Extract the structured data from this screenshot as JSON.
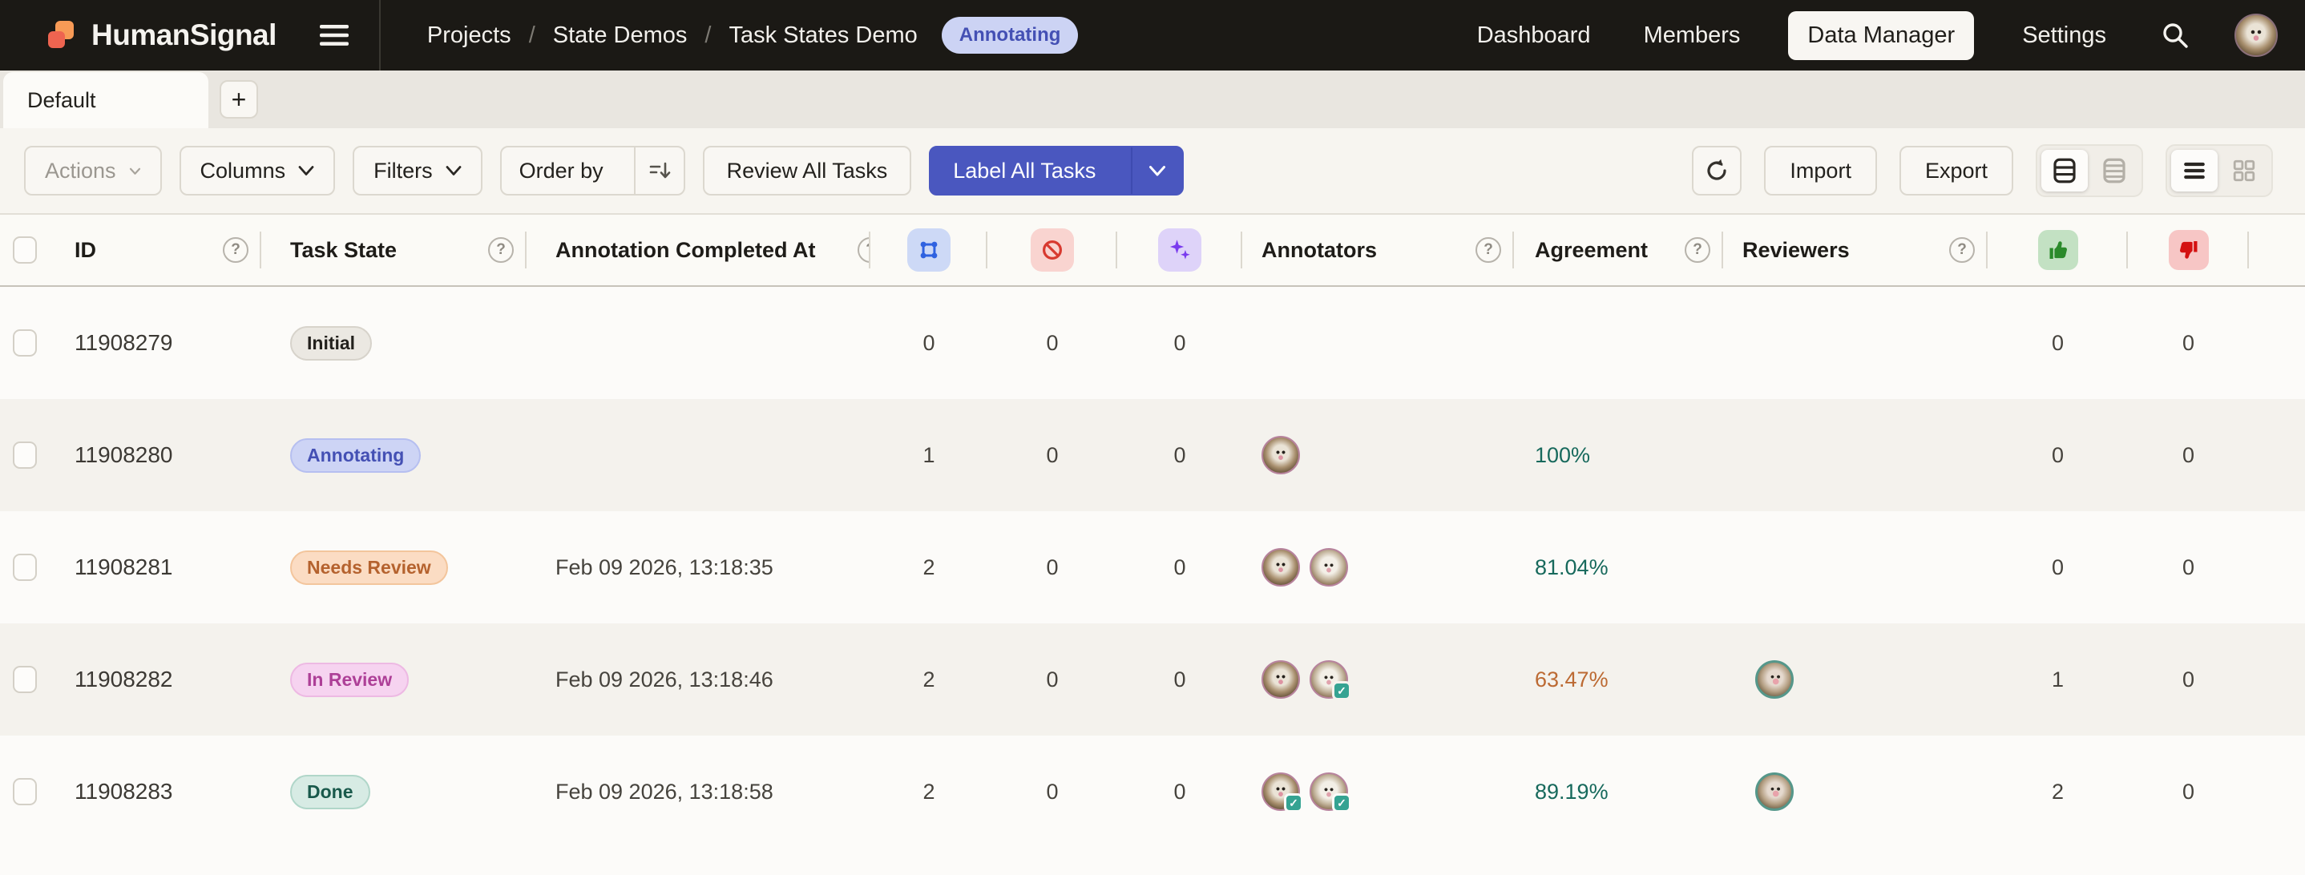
{
  "colors": {
    "primary": "#4a57bf",
    "navbar_bg": "#1b1915",
    "agreement_high": "#17695c",
    "agreement_mid": "#bc6a33",
    "annotations_icon": "#2f62e0",
    "skipped_icon": "#d83a30",
    "predictions_icon": "#7a3bee",
    "accepted_icon": "#2b8a2b",
    "rejected_icon": "#d41111"
  },
  "icons": {
    "hamburger": "menu",
    "search": "magnifier",
    "refresh": "circular-arrow",
    "order_by_sort": "lines-with-down-arrow",
    "annotations_column": "bounding-box-corner-dots",
    "skipped_column": "ban-circle",
    "predictions_column": "sparkles",
    "accepted_column": "thumbs-up",
    "rejected_column": "thumbs-down",
    "help": "?",
    "check": "✓",
    "row_density": "tall-rows / compact-rows",
    "view_mode": "list / grid"
  },
  "navbar": {
    "brand": "HumanSignal",
    "breadcrumb": [
      "Projects",
      "State Demos",
      "Task States Demo"
    ],
    "project_status_badge": "Annotating",
    "links": {
      "dashboard": "Dashboard",
      "members": "Members",
      "data_manager": "Data Manager",
      "settings": "Settings"
    }
  },
  "tabs": {
    "default_label": "Default",
    "add_label": "+"
  },
  "toolbar": {
    "actions": "Actions",
    "columns": "Columns",
    "filters": "Filters",
    "order_by": "Order by",
    "review_all": "Review All Tasks",
    "label_all": "Label All Tasks",
    "import": "Import",
    "export": "Export"
  },
  "table": {
    "headers": {
      "id": "ID",
      "task_state": "Task State",
      "completed_at": "Annotation Completed At",
      "annotators": "Annotators",
      "agreement": "Agreement",
      "reviewers": "Reviewers"
    },
    "state_styles": {
      "Initial": {
        "bg": "#ebe8e2",
        "text": "#23211d"
      },
      "Annotating": {
        "bg": "#cdd4f5",
        "text": "#4450b4"
      },
      "Needs Review": {
        "bg": "#fbdcc3",
        "text": "#b5622e"
      },
      "In Review": {
        "bg": "#f6d3f0",
        "text": "#ad3f97"
      },
      "Done": {
        "bg": "#d7ebe4",
        "text": "#19594b"
      }
    },
    "rows": [
      {
        "id": "11908279",
        "state": "Initial",
        "completed_at": "",
        "annotations": "0",
        "skipped": "0",
        "predictions": "0",
        "agreement": "",
        "accepted": "0",
        "rejected": "0"
      },
      {
        "id": "11908280",
        "state": "Annotating",
        "completed_at": "",
        "annotations": "1",
        "skipped": "0",
        "predictions": "0",
        "agreement": "100%",
        "accepted": "0",
        "rejected": "0"
      },
      {
        "id": "11908281",
        "state": "Needs Review",
        "completed_at": "Feb 09 2026, 13:18:35",
        "annotations": "2",
        "skipped": "0",
        "predictions": "0",
        "agreement": "81.04%",
        "accepted": "0",
        "rejected": "0"
      },
      {
        "id": "11908282",
        "state": "In Review",
        "completed_at": "Feb 09 2026, 13:18:46",
        "annotations": "2",
        "skipped": "0",
        "predictions": "0",
        "agreement": "63.47%",
        "accepted": "1",
        "rejected": "0"
      },
      {
        "id": "11908283",
        "state": "Done",
        "completed_at": "Feb 09 2026, 13:18:58",
        "annotations": "2",
        "skipped": "0",
        "predictions": "0",
        "agreement": "89.19%",
        "accepted": "2",
        "rejected": "0"
      }
    ]
  }
}
